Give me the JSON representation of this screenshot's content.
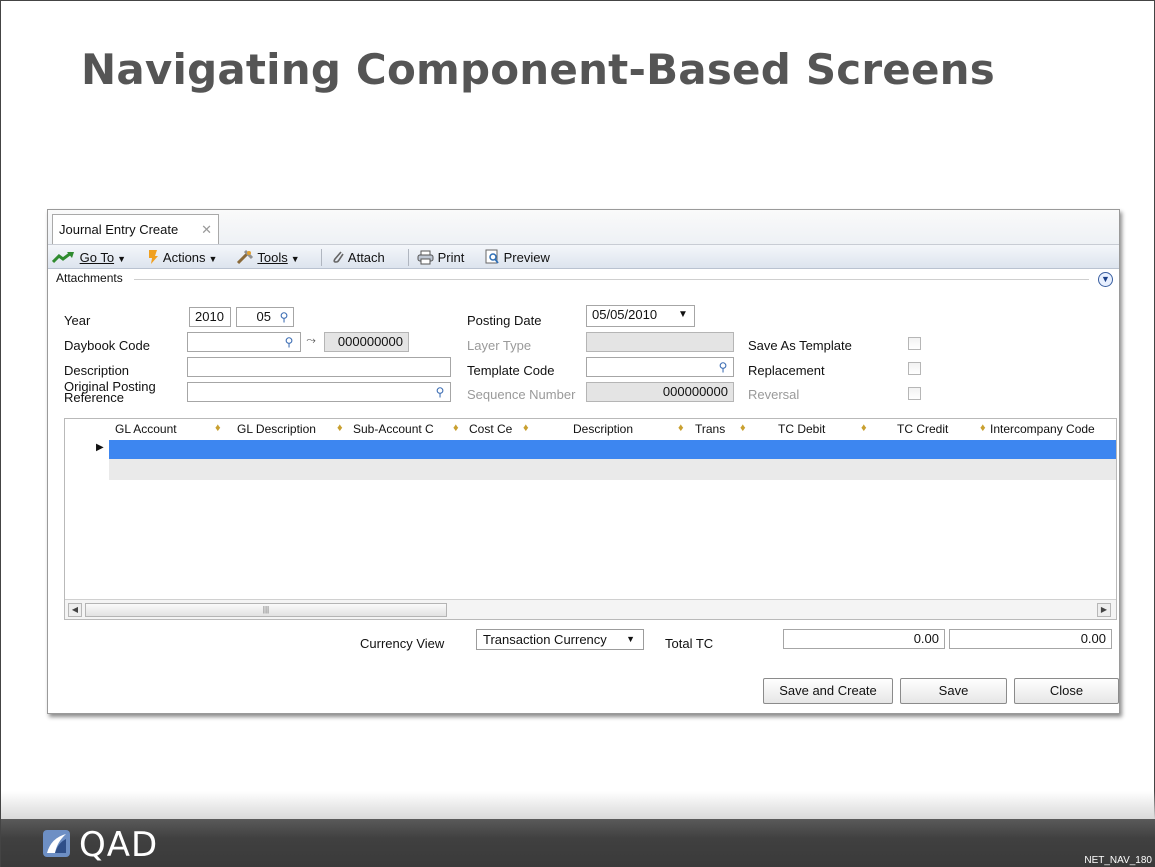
{
  "slide": {
    "title": "Navigating Component-Based Screens",
    "slide_code": "NET_NAV_180",
    "logo_text": "QAD"
  },
  "window": {
    "tab_label": "Journal Entry Create",
    "tab_close": "✕"
  },
  "toolbar": {
    "goto_label": "Go To",
    "actions_label": "Actions",
    "tools_label": "Tools",
    "attach_label": "Attach",
    "print_label": "Print",
    "preview_label": "Preview"
  },
  "attachments": {
    "label": "Attachments"
  },
  "form": {
    "year_label": "Year",
    "year_value": "2010",
    "period_value": "05",
    "daybook_label": "Daybook Code",
    "daybook_value": "",
    "daybook_number": "000000000",
    "description_label": "Description",
    "description_value": "",
    "orig_ref_label_1": "Original Posting",
    "orig_ref_label_2": "Reference",
    "orig_ref_value": "",
    "posting_date_label": "Posting Date",
    "posting_date_value": "05/05/2010",
    "layer_type_label": "Layer Type",
    "layer_type_value": "",
    "template_code_label": "Template Code",
    "template_code_value": "",
    "sequence_label": "Sequence Number",
    "sequence_value": "000000000",
    "save_template_label": "Save As Template",
    "replacement_label": "Replacement",
    "reversal_label": "Reversal"
  },
  "grid": {
    "columns": [
      "GL Account",
      "GL Description",
      "Sub-Account C",
      "Cost Ce",
      "Description",
      "Trans",
      "TC Debit",
      "TC Credit",
      "Intercompany Code"
    ]
  },
  "totals": {
    "currency_view_label": "Currency View",
    "currency_view_value": "Transaction Currency",
    "total_tc_label": "Total TC",
    "debit_total": "0.00",
    "credit_total": "0.00"
  },
  "buttons": {
    "save_create": "Save and Create",
    "save": "Save",
    "close": "Close"
  },
  "colors": {
    "title": "#555555",
    "selected_row": "#3d86f0",
    "footer": "#404040"
  }
}
